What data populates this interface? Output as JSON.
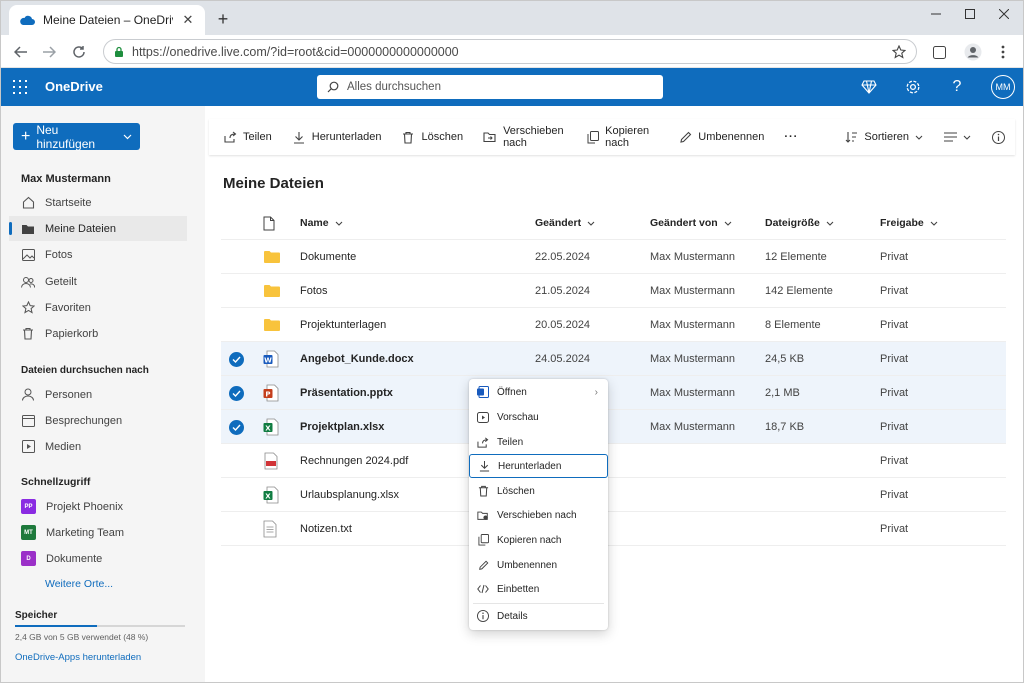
{
  "browser": {
    "tab_title": "Meine Dateien – OneDrive",
    "url": "https://onedrive.live.com/?id=root&cid=0000000000000000"
  },
  "header": {
    "brand": "OneDrive",
    "search_placeholder": "Alles durchsuchen",
    "avatar_initials": "MM"
  },
  "sidebar": {
    "new_button": "Neu hinzufügen",
    "user_name": "Max Mustermann",
    "items": [
      {
        "label": "Startseite"
      },
      {
        "label": "Meine Dateien"
      },
      {
        "label": "Fotos"
      },
      {
        "label": "Geteilt"
      },
      {
        "label": "Favoriten"
      },
      {
        "label": "Papierkorb"
      }
    ],
    "browse_title": "Dateien durchsuchen nach",
    "browse_items": [
      {
        "label": "Personen"
      },
      {
        "label": "Besprechungen"
      },
      {
        "label": "Medien"
      }
    ],
    "quick_title": "Schnellzugriff",
    "quick_items": [
      {
        "label": "Projekt Phoenix",
        "badge": "PP",
        "color": "#8a2be2"
      },
      {
        "label": "Marketing Team",
        "badge": "MT",
        "color": "#1e7a3c"
      },
      {
        "label": "Dokumente",
        "badge": "D",
        "color": "#9b30c8"
      }
    ],
    "more_link": "Weitere Orte...",
    "storage_title": "Speicher",
    "storage_text": "2,4 GB von 5 GB verwendet (48 %)",
    "storage_percent": 48,
    "apps_link": "OneDrive-Apps herunterladen"
  },
  "commandbar": {
    "share": "Teilen",
    "download": "Herunterladen",
    "delete": "Löschen",
    "move": "Verschieben nach",
    "copy": "Kopieren nach",
    "rename": "Umbenennen",
    "more": "···",
    "sort": "Sortieren"
  },
  "main": {
    "title": "Meine Dateien",
    "columns": {
      "name": "Name",
      "modified": "Geändert",
      "modified_by": "Geändert von",
      "size": "Dateigröße",
      "sharing": "Freigabe"
    },
    "files": [
      {
        "name": "Dokumente",
        "type": "folder",
        "modified": "22.05.2024",
        "by": "Max Mustermann",
        "size": "12 Elemente",
        "sharing": "Privat",
        "selected": false
      },
      {
        "name": "Fotos",
        "type": "folder",
        "modified": "21.05.2024",
        "by": "Max Mustermann",
        "size": "142 Elemente",
        "sharing": "Privat",
        "selected": false
      },
      {
        "name": "Projektunterlagen",
        "type": "folder",
        "modified": "20.05.2024",
        "by": "Max Mustermann",
        "size": "8 Elemente",
        "sharing": "Privat",
        "selected": false
      },
      {
        "name": "Angebot_Kunde.docx",
        "type": "word",
        "modified": "24.05.2024",
        "by": "Max Mustermann",
        "size": "24,5 KB",
        "sharing": "Privat",
        "selected": true
      },
      {
        "name": "Präsentation.pptx",
        "type": "powerpoint",
        "modified": "",
        "by": "Max Mustermann",
        "size": "2,1 MB",
        "sharing": "Privat",
        "selected": true
      },
      {
        "name": "Projektplan.xlsx",
        "type": "excel",
        "modified": "",
        "by": "Max Mustermann",
        "size": "18,7 KB",
        "sharing": "Privat",
        "selected": true
      },
      {
        "name": "Rechnungen 2024.pdf",
        "type": "pdf",
        "modified": "",
        "by": "",
        "size": "",
        "sharing": "Privat",
        "selected": false
      },
      {
        "name": "Urlaubsplanung.xlsx",
        "type": "excel",
        "modified": "",
        "by": "",
        "size": "",
        "sharing": "Privat",
        "selected": false
      },
      {
        "name": "Notizen.txt",
        "type": "text",
        "modified": "",
        "by": "",
        "size": "",
        "sharing": "Privat",
        "selected": false
      }
    ]
  },
  "context_menu": {
    "items": [
      {
        "label": "Öffnen",
        "icon": "word-app-icon",
        "submenu": true
      },
      {
        "label": "Vorschau",
        "icon": "preview-icon"
      },
      {
        "label": "Teilen",
        "icon": "share-icon"
      },
      {
        "label": "Herunterladen",
        "icon": "download-icon",
        "focused": true
      },
      {
        "label": "Löschen",
        "icon": "trash-icon"
      },
      {
        "label": "Verschieben nach",
        "icon": "move-icon"
      },
      {
        "label": "Kopieren nach",
        "icon": "copy-icon"
      },
      {
        "label": "Umbenennen",
        "icon": "pencil-icon"
      },
      {
        "label": "Einbetten",
        "icon": "code-icon"
      },
      {
        "label": "Details",
        "icon": "info-icon"
      }
    ]
  },
  "colors": {
    "accent": "#0f6cbd",
    "folder": "#f8c33c",
    "word": "#185abd",
    "powerpoint": "#c43e1c",
    "excel": "#107c41",
    "pdf": "#d13438"
  }
}
